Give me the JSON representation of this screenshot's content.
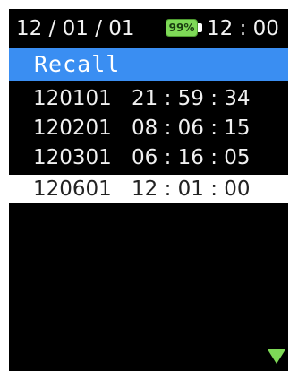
{
  "status": {
    "date": "12 / 01 / 01",
    "battery": "99%",
    "time": "12 : 00"
  },
  "header": {
    "title": "Recall"
  },
  "records": [
    {
      "code": "120101",
      "time": "21 : 59 : 34"
    },
    {
      "code": "120201",
      "time": "08 : 06 : 15"
    },
    {
      "code": "120301",
      "time": "06 : 16 : 05"
    },
    {
      "code": "120601",
      "time": "12 : 01 : 00"
    }
  ],
  "selected_index": 3,
  "icons": {
    "battery": "battery-icon",
    "scroll": "scroll-down-icon"
  },
  "colors": {
    "header": "#3a8ef2",
    "battery": "#7ed957",
    "arrow": "#7ed957"
  }
}
